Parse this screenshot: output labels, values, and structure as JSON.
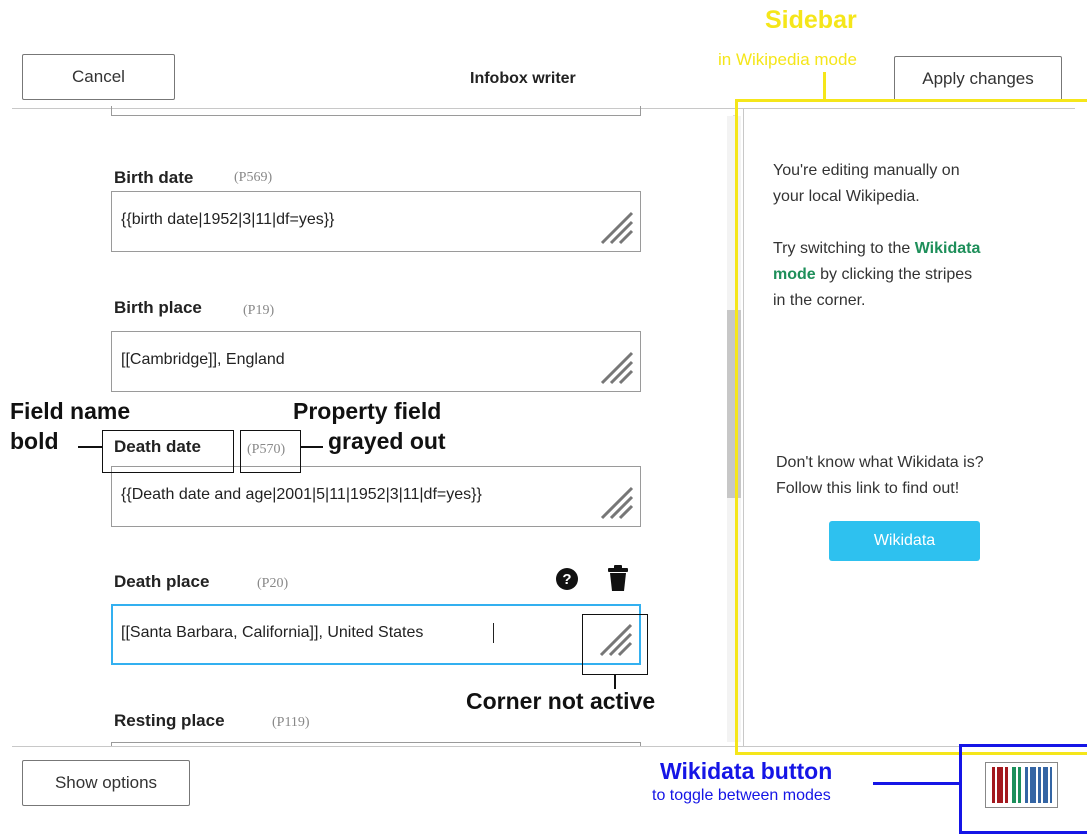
{
  "header": {
    "cancel_label": "Cancel",
    "title": "Infobox writer",
    "apply_label": "Apply changes"
  },
  "fields": [
    {
      "label": "Birth date",
      "property": "(P569)",
      "value": "{{birth date|1952|3|11|df=yes}}"
    },
    {
      "label": "Birth place",
      "property": "(P19)",
      "value": "[[Cambridge]], England"
    },
    {
      "label": "Death date",
      "property": "(P570)",
      "value": "{{Death date and age|2001|5|11|1952|3|11|df=yes}}"
    },
    {
      "label": "Death place",
      "property": "(P20)",
      "value": "[[Santa Barbara, California]], United States"
    },
    {
      "label": "Resting place",
      "property": "(P119)",
      "value": ""
    }
  ],
  "field_icons": [
    "question-circle-icon",
    "trash-icon"
  ],
  "sidebar": {
    "line1": "You're editing manually on",
    "line2": "your local Wikipedia.",
    "line3_pre": "Try switching to the ",
    "line3_link": "Wikidata",
    "line4_link": "mode",
    "line4_post": " by clicking the stripes",
    "line5": "in the corner.",
    "line6": "Don't know what Wikidata is?",
    "line7": "Follow this link to find out!",
    "wikidata_button": "Wikidata",
    "link_color": "#1e8f5a",
    "button_color": "#2ec1ef"
  },
  "footer": {
    "options_label": "Show options",
    "barcode_colors": [
      "#a3181e",
      "#1b8f5b",
      "#3465a4"
    ]
  },
  "annotations": {
    "sidebar_title": "Sidebar",
    "sidebar_sub": "in Wikipedia mode",
    "field_name_1": "Field name",
    "field_name_2": "bold",
    "property_1": "Property field",
    "property_2": "grayed out",
    "corner": "Corner not active",
    "wd_button_title": "Wikidata button",
    "wd_button_sub": "to toggle between modes",
    "colors": {
      "yellow": "#f5e61a",
      "blue": "#1515e6",
      "black": "#111111"
    }
  }
}
